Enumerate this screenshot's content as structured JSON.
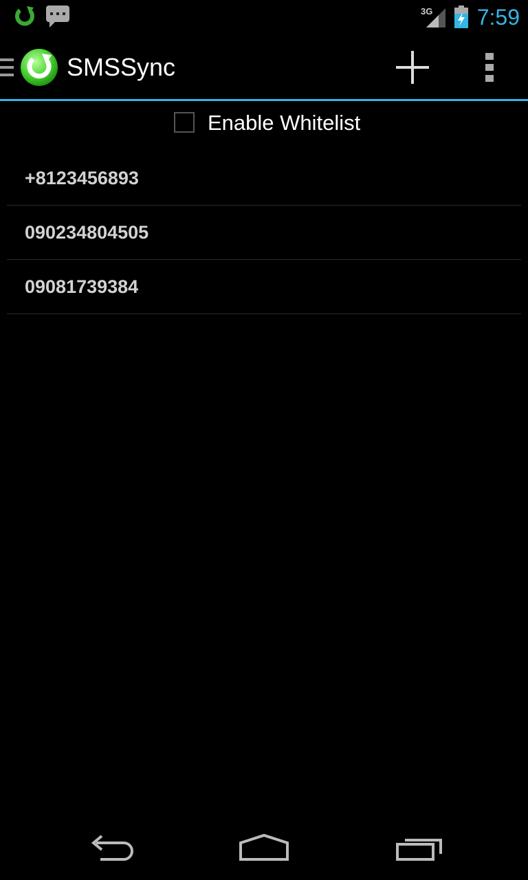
{
  "status_bar": {
    "network_type": "3G",
    "time": "7:59",
    "notifications": [
      "sync-icon",
      "message-icon"
    ]
  },
  "action_bar": {
    "title": "SMSSync",
    "actions": [
      "add-icon",
      "overflow-menu-icon"
    ]
  },
  "whitelist": {
    "label": "Enable Whitelist",
    "checked": false
  },
  "numbers": [
    {
      "value": "+8123456893"
    },
    {
      "value": "090234804505"
    },
    {
      "value": "09081739384"
    }
  ],
  "nav_bar": {
    "buttons": [
      "back-icon",
      "home-icon",
      "recents-icon"
    ]
  },
  "colors": {
    "accent": "#33b5e5",
    "brand_green": "#5bd84c"
  }
}
